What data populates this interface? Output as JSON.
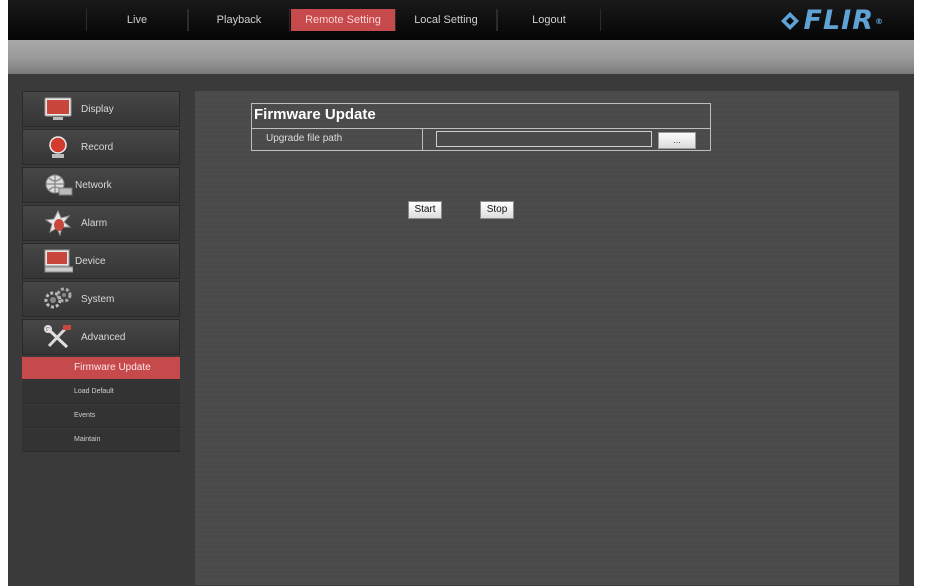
{
  "topnav": {
    "tabs": [
      {
        "label": "Live"
      },
      {
        "label": "Playback"
      },
      {
        "label": "Remote Setting"
      },
      {
        "label": "Local Setting"
      },
      {
        "label": "Logout"
      }
    ],
    "active_tab": "Remote Setting",
    "logo": {
      "text": "FLIR",
      "registered": "®",
      "color": "#5ea2d6"
    }
  },
  "sidebar": {
    "items": [
      {
        "label": "Display",
        "icon": "monitor-icon"
      },
      {
        "label": "Record",
        "icon": "record-icon"
      },
      {
        "label": "Network",
        "icon": "network-icon"
      },
      {
        "label": "Alarm",
        "icon": "alarm-icon"
      },
      {
        "label": "Device",
        "icon": "device-icon"
      },
      {
        "label": "System",
        "icon": "gears-icon"
      },
      {
        "label": "Advanced",
        "icon": "tools-icon"
      }
    ],
    "subitems": [
      {
        "label": "Firmware Update",
        "active": true
      },
      {
        "label": "Load Default"
      },
      {
        "label": "Events"
      },
      {
        "label": "Maintain"
      }
    ]
  },
  "main": {
    "title": "Firmware Update",
    "path_label": "Upgrade file path",
    "path_value": "",
    "browse_label": "...",
    "start_label": "Start",
    "stop_label": "Stop"
  },
  "colors": {
    "accent": "#c6494c",
    "panel": "#4a4a4a",
    "topbar": "#0a0a0a"
  }
}
